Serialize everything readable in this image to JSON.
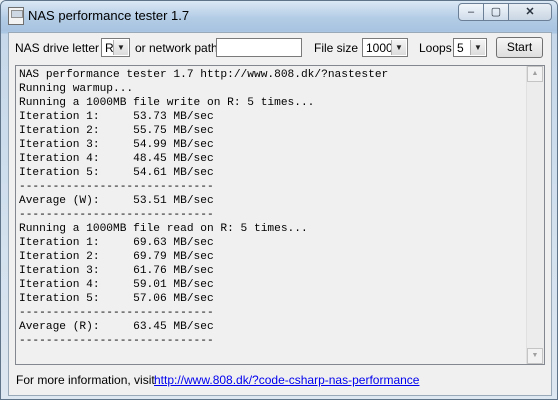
{
  "window": {
    "title": "NAS performance tester 1.7",
    "controls": {
      "minimize": "–",
      "maximize": "▢",
      "close": "✕"
    }
  },
  "toolbar": {
    "drive_label": "NAS drive letter",
    "drive_value": "R",
    "network_label": "or network path",
    "network_value": "",
    "filesize_label": "File size",
    "filesize_value": "1000",
    "loops_label": "Loops",
    "loops_value": "5",
    "start_label": "Start"
  },
  "output": {
    "lines": [
      "NAS performance tester 1.7 http://www.808.dk/?nastester",
      "Running warmup...",
      "Running a 1000MB file write on R: 5 times...",
      "Iteration 1:     53.73 MB/sec",
      "Iteration 2:     55.75 MB/sec",
      "Iteration 3:     54.99 MB/sec",
      "Iteration 4:     48.45 MB/sec",
      "Iteration 5:     54.61 MB/sec",
      "-----------------------------",
      "Average (W):     53.51 MB/sec",
      "-----------------------------",
      "Running a 1000MB file read on R: 5 times...",
      "Iteration 1:     69.63 MB/sec",
      "Iteration 2:     69.79 MB/sec",
      "Iteration 3:     61.76 MB/sec",
      "Iteration 4:     59.01 MB/sec",
      "Iteration 5:     57.06 MB/sec",
      "-----------------------------",
      "Average (R):     63.45 MB/sec",
      "-----------------------------"
    ]
  },
  "footer": {
    "text": "For more information, visit",
    "link": "http://www.808.dk/?code-csharp-nas-performance"
  }
}
